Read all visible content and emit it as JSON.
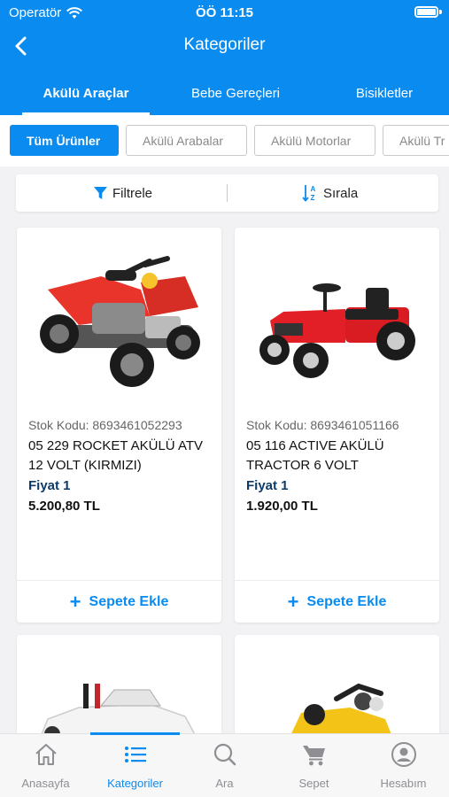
{
  "status_bar": {
    "carrier": "Operatör",
    "time": "ÖÖ 11:15"
  },
  "nav": {
    "title": "Kategoriler"
  },
  "category_tabs": [
    "Akülü Araçlar",
    "Bebe Gereçleri",
    "Bisikletler"
  ],
  "subcategories": [
    "Tüm Ürünler",
    "Akülü Arabalar",
    "Akülü Motorlar",
    "Akülü Tr"
  ],
  "filter_bar": {
    "filter_label": "Filtrele",
    "sort_label": "Sırala"
  },
  "products": [
    {
      "sku": "Stok Kodu: 8693461052293",
      "name": "05 229 ROCKET AKÜLÜ ATV 12 VOLT (KIRMIZI)",
      "price_label": "Fiyat 1",
      "price": "5.200,80 TL",
      "add_label": "Sepete Ekle"
    },
    {
      "sku": "Stok Kodu: 8693461051166",
      "name": "05 116 ACTIVE AKÜLÜ TRACTOR 6 VOLT",
      "price_label": "Fiyat 1",
      "price": "1.920,00 TL",
      "add_label": "Sepete Ekle"
    }
  ],
  "tab_bar": [
    "Anasayfa",
    "Kategoriler",
    "Ara",
    "Sepet",
    "Hesabım"
  ],
  "colors": {
    "accent": "#0a8bf0",
    "price_label": "#0d3a66"
  }
}
